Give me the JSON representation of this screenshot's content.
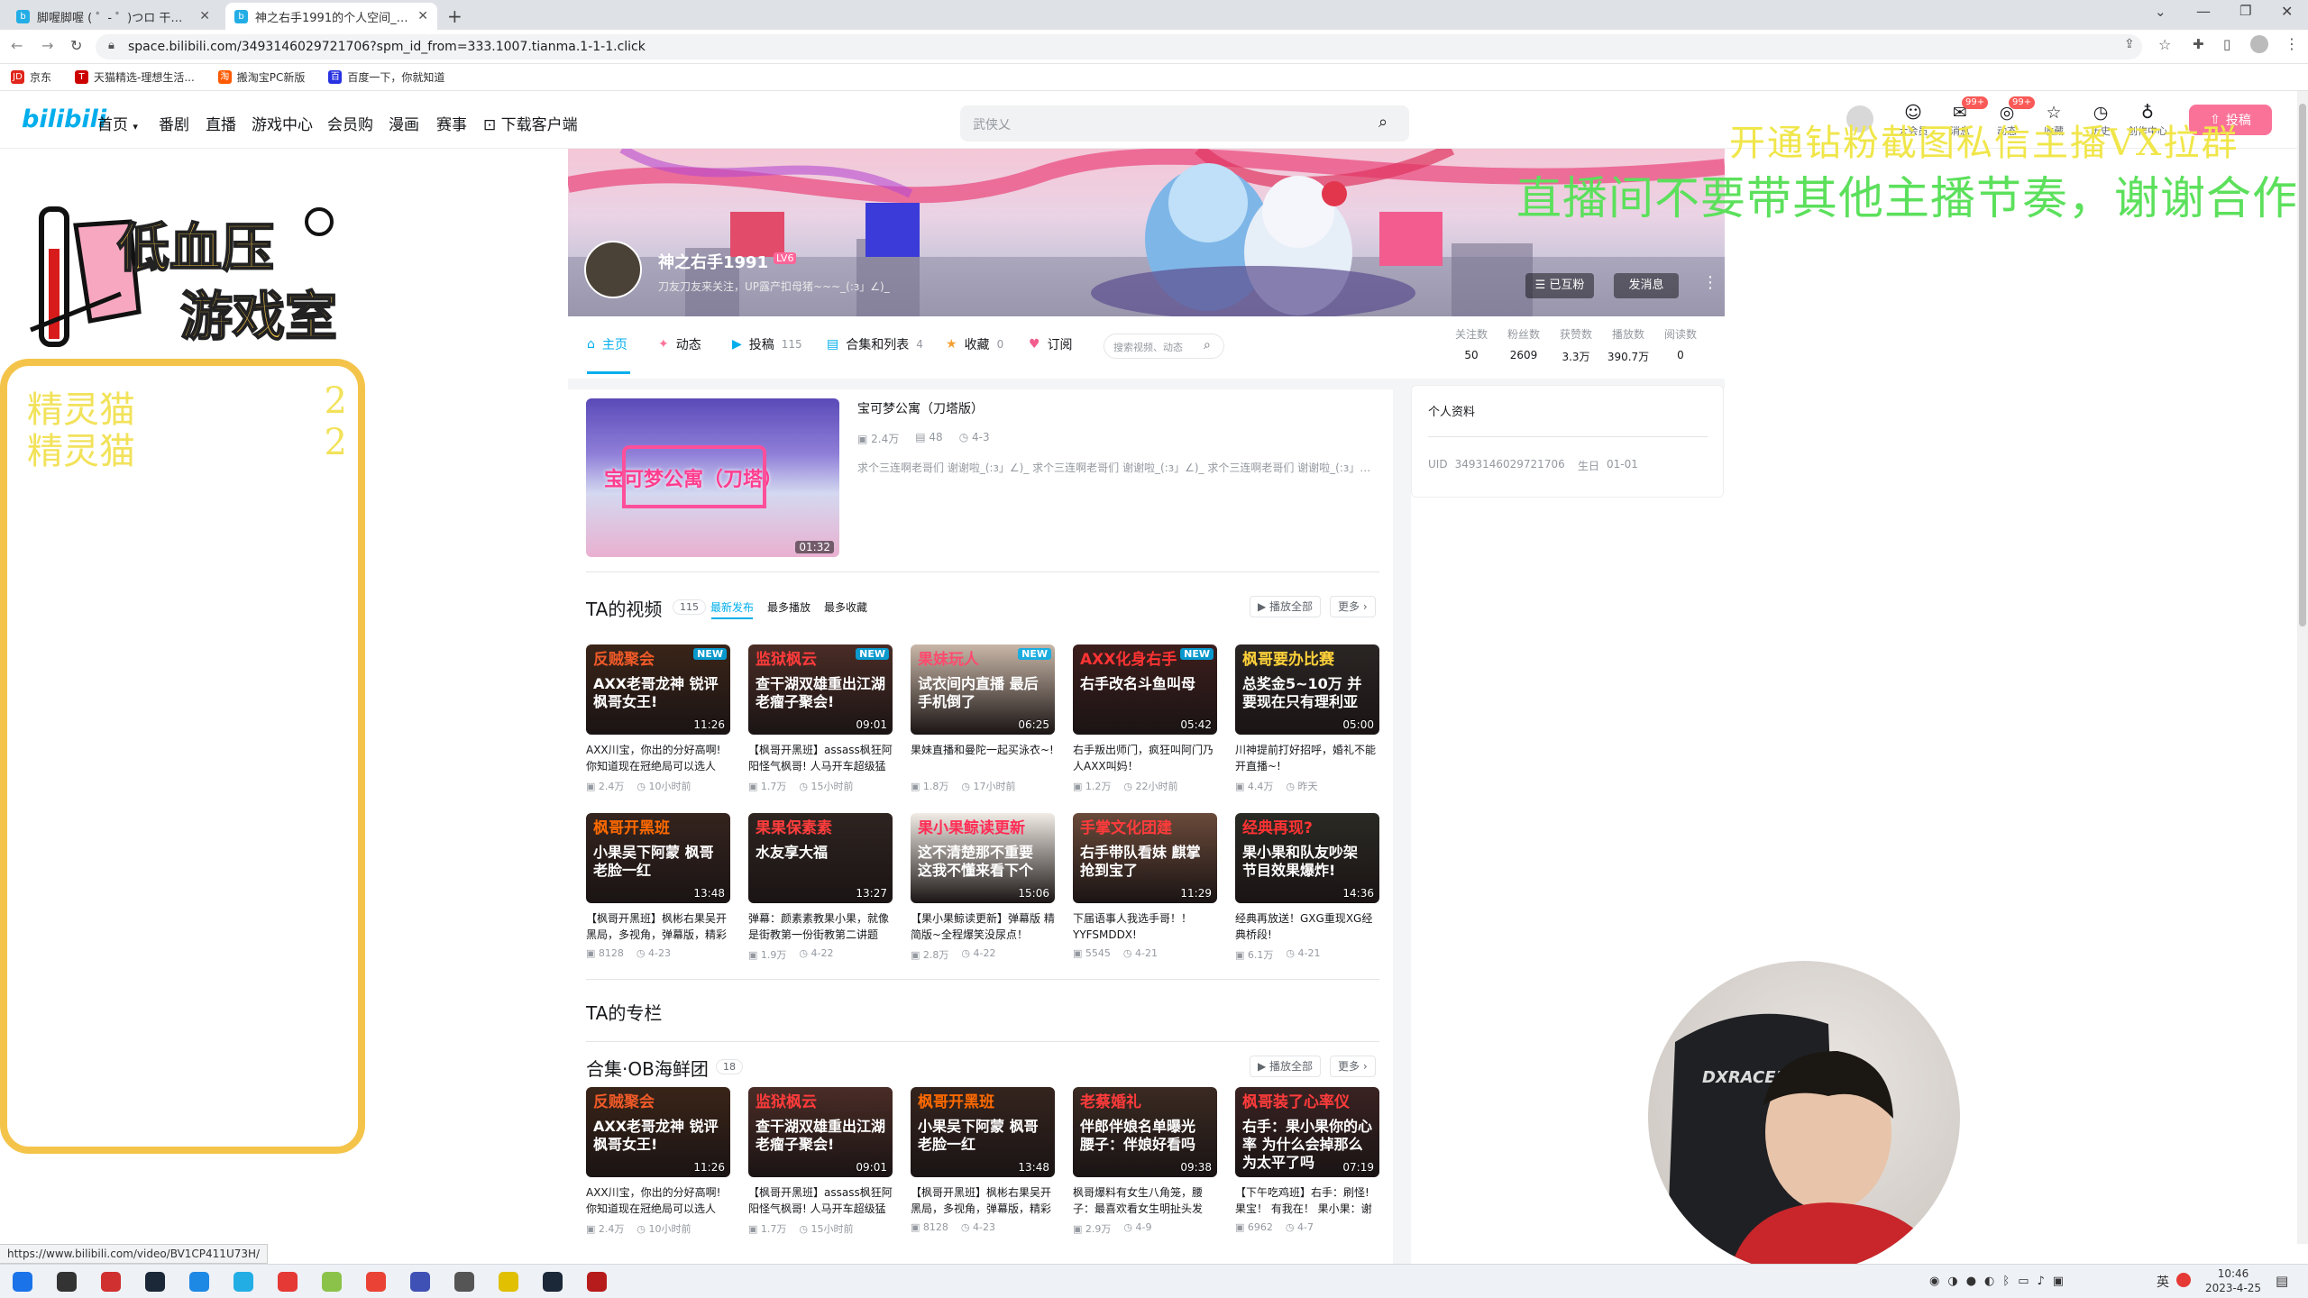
{
  "browser": {
    "tabs": [
      {
        "title": "脚喔脚喔 ( ゜- ゜)つロ 干杯~-bili",
        "icon": "bili"
      },
      {
        "title": "神之右手1991的个人空间_哔哩",
        "icon": "bili"
      }
    ],
    "new_tab_label": "+",
    "url": "space.bilibili.com/3493146029721706?spm_id_from=333.1007.tianma.1-1-1.click",
    "bookmarks": [
      "京东",
      "天猫精选-理想生活...",
      "搬淘宝PC新版",
      "百度一下，你就知道"
    ],
    "status_url": "https://www.bilibili.com/video/BV1CP411U73H/"
  },
  "bili_nav": {
    "logo": "bilibili",
    "items": [
      "首页",
      "番剧",
      "直播",
      "游戏中心",
      "会员购",
      "漫画",
      "赛事",
      "下载客户端"
    ],
    "search_placeholder": "武侠乂",
    "right_icons": [
      {
        "label": "大会员",
        "glyph": "☺",
        "badge": ""
      },
      {
        "label": "消息",
        "glyph": "✉",
        "badge": "99+"
      },
      {
        "label": "动态",
        "glyph": "◎",
        "badge": "99+"
      },
      {
        "label": "收藏",
        "glyph": "☆",
        "badge": ""
      },
      {
        "label": "历史",
        "glyph": "◷",
        "badge": ""
      },
      {
        "label": "创作中心",
        "glyph": "♁",
        "badge": ""
      }
    ],
    "upload_label": "投稿"
  },
  "profile": {
    "name": "神之右手1991",
    "level": "LV6",
    "sign": "刀友刀友来关注，UP露产扣母猪~~~_(:з」∠)_",
    "follow_btn": "已互粉",
    "message_btn": "发消息",
    "tabs": [
      {
        "label": "主页",
        "count": "",
        "color": "#00aeec"
      },
      {
        "label": "动态",
        "count": "",
        "color": "#fb7299"
      },
      {
        "label": "投稿",
        "count": "115",
        "color": "#00aeec"
      },
      {
        "label": "合集和列表",
        "count": "4",
        "color": "#00aeec"
      },
      {
        "label": "收藏",
        "count": "0",
        "color": "#f3a034"
      },
      {
        "label": "订阅",
        "count": "",
        "color": "#f25d8e"
      }
    ],
    "search_placeholder": "搜索视频、动态",
    "stats": [
      {
        "label": "关注数",
        "value": "50"
      },
      {
        "label": "粉丝数",
        "value": "2609"
      },
      {
        "label": "获赞数",
        "value": "3.3万"
      },
      {
        "label": "播放数",
        "value": "390.7万"
      },
      {
        "label": "阅读数",
        "value": "0"
      }
    ]
  },
  "featured": {
    "title": "宝可梦公寓（刀塔版）",
    "thumb_text": "宝可梦公寓（刀塔）",
    "duration": "01:32",
    "plays": "2.4万",
    "danmaku": "48",
    "date": "4-3",
    "desc": "求个三连啊老哥们 谢谢啦_(:з」∠)_ 求个三连啊老哥们 谢谢啦_(:з」∠)_ 求个三连啊老哥们 谢谢啦_(:з」∠)_"
  },
  "videos_section": {
    "title": "TA的视频",
    "count": "115",
    "sorts": [
      "最新发布",
      "最多播放",
      "最多收藏"
    ],
    "play_all": "播放全部",
    "more": "更多",
    "videos": [
      {
        "t1": "反贼聚会",
        "t2": "AXX老哥龙神 锐评枫哥女王!",
        "new": true,
        "dur": "11:26",
        "title": "AXX川宝，你出的分好高啊! 你知道现在冠绝局可以选人",
        "plays": "2.4万",
        "date": "10小时前",
        "bg": "#3a2418",
        "c1": "#f05a28"
      },
      {
        "t1": "监狱枫云",
        "t2": "查干湖双雄重出江湖 老瘤子聚会!",
        "new": true,
        "dur": "09:01",
        "title": "【枫哥开黑班】assass枫狂阿阳怪气枫哥! 人马开车超级猛",
        "plays": "1.7万",
        "date": "15小时前",
        "bg": "#4a2c26",
        "c1": "#ff3b3b"
      },
      {
        "t1": "果妹玩人",
        "t2": "试衣间内直播 最后手机倒了",
        "new": true,
        "dur": "06:25",
        "title": "果妹直播和曼陀一起买泳衣~!",
        "plays": "1.8万",
        "date": "17小时前",
        "bg": "#c9b7a8",
        "c1": "#ff4a6e"
      },
      {
        "t1": "AXX化身右手",
        "t2": "右手改名斗鱼叫母",
        "new": true,
        "dur": "05:42",
        "title": "右手叛出师门，疯狂叫阿门乃人AXX叫妈！",
        "plays": "1.2万",
        "date": "22小时前",
        "bg": "#3c1e1c",
        "c1": "#ff3333"
      },
      {
        "t1": "枫哥要办比赛",
        "t2": "总奖金5~10万 并要现在只有理利亚",
        "new": false,
        "dur": "05:00",
        "title": "川神提前打好招呼，婚礼不能开直播~!",
        "plays": "4.4万",
        "date": "昨天",
        "bg": "#2a2624",
        "c1": "#ffd23a"
      },
      {
        "t1": "枫哥开黑班",
        "t2": "小果吴下阿蒙 枫哥老脸一红",
        "new": false,
        "dur": "13:48",
        "title": "【枫哥开黑班】枫彬右果吴开黑局，多视角，弹幕版，精彩",
        "plays": "8128",
        "date": "4-23",
        "bg": "#35241e",
        "c1": "#ff6a00"
      },
      {
        "t1": "果果保素素",
        "t2": "水友享大福",
        "new": false,
        "dur": "13:27",
        "title": "弹幕：颜素素教果小果，就像是街教第一份街教第二讲题",
        "plays": "1.9万",
        "date": "4-22",
        "bg": "#2e2420",
        "c1": "#ff3d3d"
      },
      {
        "t1": "果小果鲸读更新",
        "t2": "这不清楚那不重要 这我不懂来看下个",
        "new": false,
        "dur": "15:06",
        "title": "【果小果鲸读更新】弹幕版 精简版~全程爆笑没尿点！",
        "plays": "2.8万",
        "date": "4-22",
        "bg": "#f2ece6",
        "c1": "#ff2d55"
      },
      {
        "t1": "手掌文化团建",
        "t2": "右手带队看妹 麒掌抢到宝了",
        "new": false,
        "dur": "11:29",
        "title": "下届语事人我选手哥！！ YYFSMDDX!",
        "plays": "5545",
        "date": "4-21",
        "bg": "#6a4a3a",
        "c1": "#ff3b3b"
      },
      {
        "t1": "经典再现?",
        "t2": "果小果和队友吵架 节目效果爆炸!",
        "new": false,
        "dur": "14:36",
        "title": "经典再放送！GXG重现XG经典桥段!",
        "plays": "6.1万",
        "date": "4-21",
        "bg": "#2a2a24",
        "c1": "#ff3333"
      }
    ]
  },
  "articles_title": "TA的专栏",
  "collection": {
    "title": "合集·OB海鲜团",
    "count": "18",
    "play_all": "播放全部",
    "more": "更多",
    "videos": [
      {
        "t1": "反贼聚会",
        "t2": "AXX老哥龙神 锐评枫哥女王!",
        "dur": "11:26",
        "title": "AXX川宝，你出的分好高啊! 你知道现在冠绝局可以选人",
        "plays": "2.4万",
        "date": "10小时前",
        "bg": "#3a2418",
        "c1": "#f05a28"
      },
      {
        "t1": "监狱枫云",
        "t2": "查干湖双雄重出江湖 老瘤子聚会!",
        "dur": "09:01",
        "title": "【枫哥开黑班】assass枫狂阿阳怪气枫哥! 人马开车超级猛",
        "plays": "1.7万",
        "date": "15小时前",
        "bg": "#4a2c26",
        "c1": "#ff3b3b"
      },
      {
        "t1": "枫哥开黑班",
        "t2": "小果吴下阿蒙 枫哥老脸一红",
        "dur": "13:48",
        "title": "【枫哥开黑班】枫彬右果吴开黑局，多视角，弹幕版，精彩",
        "plays": "8128",
        "date": "4-23",
        "bg": "#35241e",
        "c1": "#ff6a00"
      },
      {
        "t1": "老蔡婚礼",
        "t2": "伴郎伴娘名单曝光 腰子：伴娘好看吗",
        "dur": "09:38",
        "title": "枫哥爆料有女生八角笼，腰子：最喜欢看女生明扯头发",
        "plays": "2.9万",
        "date": "4-9",
        "bg": "#3a2a22",
        "c1": "#ff3b3b"
      },
      {
        "t1": "枫哥装了心率仪",
        "t2": "右手：果小果你的心率 为什么会掉那么为太平了吗",
        "dur": "07:19",
        "title": "【下午吃鸡班】右手：刷怪! 果宝！ 有我在！ 果小果：谢谢",
        "plays": "6962",
        "date": "4-7",
        "bg": "#3a2222",
        "c1": "#ff3b3b"
      }
    ]
  },
  "sidebar_profile": {
    "title": "个人资料",
    "uid_label": "UID",
    "uid": "3493146029721706",
    "birthday_label": "生日",
    "birthday": "01-01"
  },
  "stream_overlay": {
    "logo_line1": "低血压",
    "logo_line2": "游戏室",
    "marquee1": "开通钻粉截图私信主播VX拉群",
    "marquee2": "直播间不要带其他主播节奏，谢谢合作",
    "list": [
      {
        "name": "精灵猫",
        "count": "2"
      },
      {
        "name": "精灵猫",
        "count": "2"
      }
    ]
  },
  "taskbar": {
    "time": "10:46",
    "date": "2023-4-25",
    "ime": "英",
    "apps": [
      {
        "name": "start-icon",
        "color": "#1a73e8"
      },
      {
        "name": "search-icon",
        "color": "#333333"
      },
      {
        "name": "app-icon-1",
        "color": "#d03030"
      },
      {
        "name": "steam-icon",
        "color": "#1b2838"
      },
      {
        "name": "app-icon-2",
        "color": "#1e88e5"
      },
      {
        "name": "bilibili-icon",
        "color": "#23ade5"
      },
      {
        "name": "app-icon-3",
        "color": "#e53935"
      },
      {
        "name": "app-icon-4",
        "color": "#8bc34a"
      },
      {
        "name": "chrome-icon",
        "color": "#ea4335"
      },
      {
        "name": "app-icon-5",
        "color": "#3f51b5"
      },
      {
        "name": "app-icon-6",
        "color": "#555555"
      },
      {
        "name": "app-icon-7",
        "color": "#e0c000"
      },
      {
        "name": "steam-icon-2",
        "color": "#1b2838"
      },
      {
        "name": "dota-icon",
        "color": "#b71c1c"
      }
    ]
  },
  "colors": {
    "accent": "#00aeec",
    "pink": "#fb7299",
    "overlay_yellow": "#f4c44a"
  }
}
